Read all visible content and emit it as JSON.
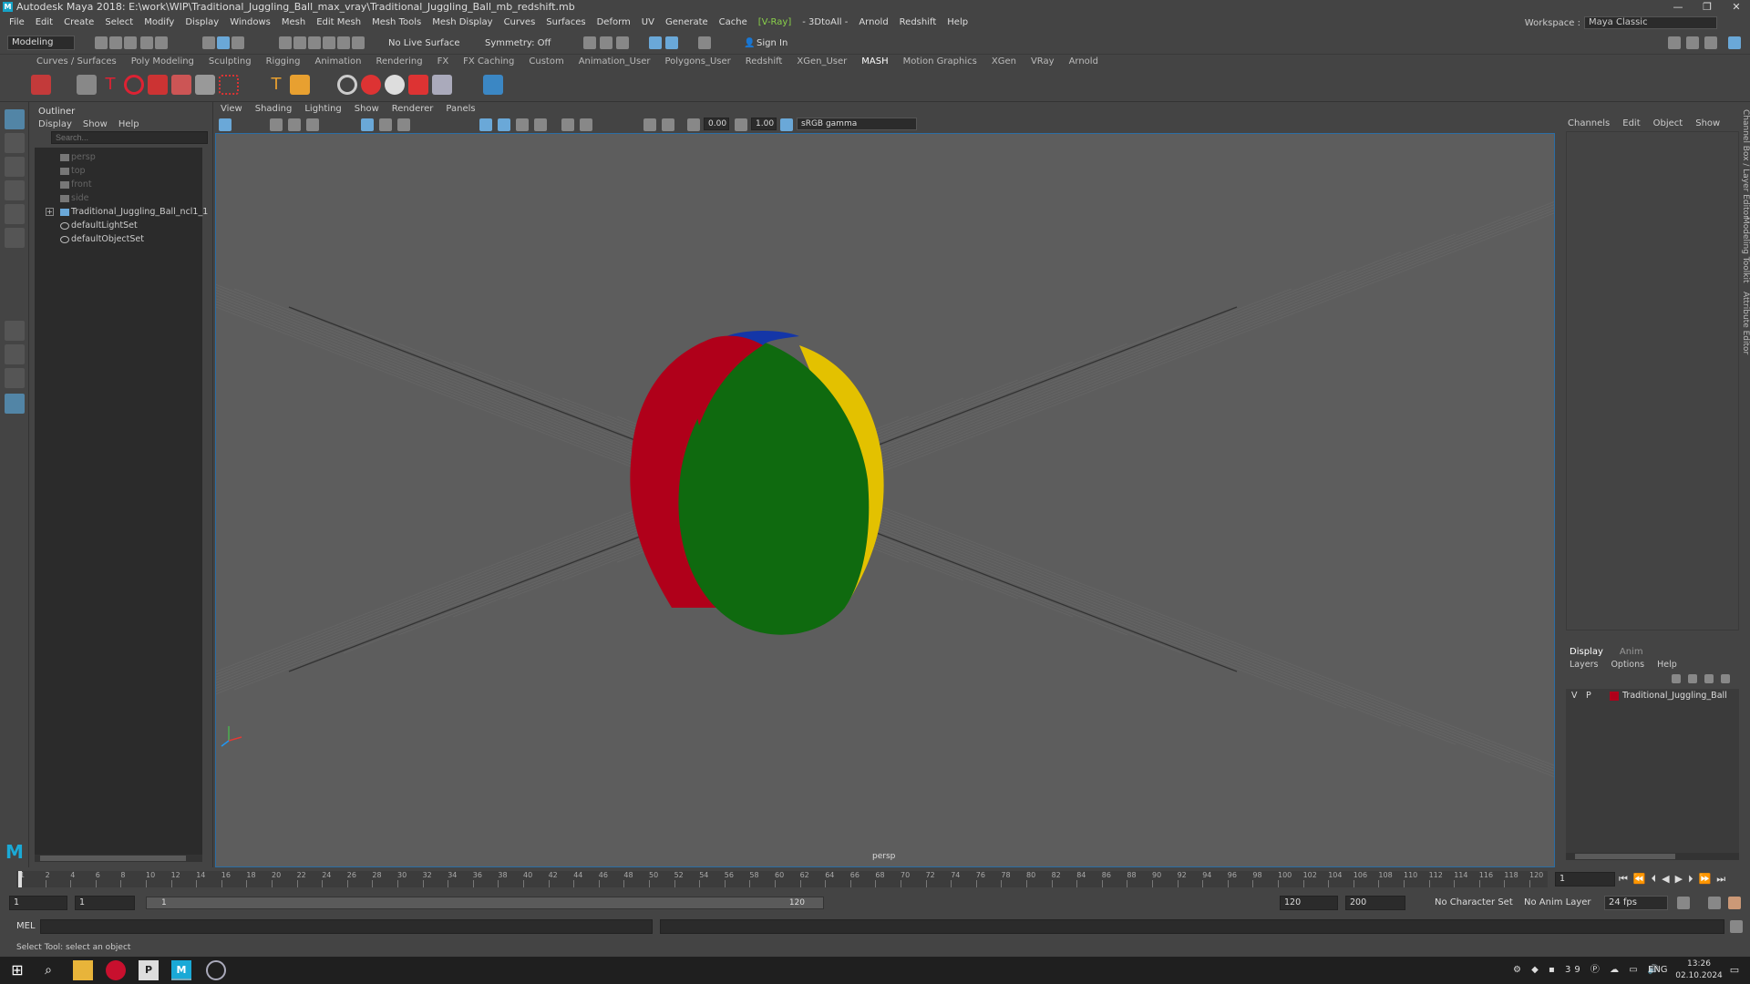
{
  "window": {
    "title": "Autodesk Maya 2018: E:\\work\\WIP\\Traditional_Juggling_Ball_max_vray\\Traditional_Juggling_Ball_mb_redshift.mb",
    "controls": [
      "—",
      "❐",
      "✕"
    ]
  },
  "menubar": {
    "items": [
      "File",
      "Edit",
      "Create",
      "Select",
      "Modify",
      "Display",
      "Windows",
      "Mesh",
      "Edit Mesh",
      "Mesh Tools",
      "Mesh Display",
      "Curves",
      "Surfaces",
      "Deform",
      "UV",
      "Generate",
      "Cache",
      "[V-Ray]",
      "- 3DtoAll -",
      "Arnold",
      "Redshift",
      "Help"
    ],
    "workspace_label": "Workspace :",
    "workspace_value": "Maya Classic"
  },
  "statusline": {
    "mode": "Modeling",
    "live_surface": "No Live Surface",
    "symmetry": "Symmetry: Off",
    "sign_in": "Sign In"
  },
  "shelf": {
    "tabs": [
      "Curves / Surfaces",
      "Poly Modeling",
      "Sculpting",
      "Rigging",
      "Animation",
      "Rendering",
      "FX",
      "FX Caching",
      "Custom",
      "Animation_User",
      "Polygons_User",
      "Redshift",
      "XGen_User",
      "MASH",
      "Motion Graphics",
      "XGen",
      "VRay",
      "Arnold"
    ],
    "active_tab": "MASH"
  },
  "outliner": {
    "title": "Outliner",
    "menu": [
      "Display",
      "Show",
      "Help"
    ],
    "search_placeholder": "Search...",
    "items": [
      {
        "label": "persp",
        "dim": true
      },
      {
        "label": "top",
        "dim": true
      },
      {
        "label": "front",
        "dim": true
      },
      {
        "label": "side",
        "dim": true
      },
      {
        "label": "Traditional_Juggling_Ball_ncl1_1",
        "dim": false
      },
      {
        "label": "defaultLightSet",
        "dim": false
      },
      {
        "label": "defaultObjectSet",
        "dim": false
      }
    ]
  },
  "viewport": {
    "menu": [
      "View",
      "Shading",
      "Lighting",
      "Show",
      "Renderer",
      "Panels"
    ],
    "exposure": "0.00",
    "gamma": "1.00",
    "colorspace": "sRGB gamma",
    "camera_label": "persp",
    "ball_colors": {
      "red": "#b0001a",
      "green": "#0f6a0f",
      "yellow": "#e3c100",
      "blue": "#1436a8"
    }
  },
  "channelbox": {
    "menu": [
      "Channels",
      "Edit",
      "Object",
      "Show"
    ],
    "layer_tabs": [
      "Display",
      "Anim"
    ],
    "layer_menu": [
      "Layers",
      "Options",
      "Help"
    ],
    "layer": {
      "v": "V",
      "p": "P",
      "name": "Traditional_Juggling_Ball",
      "color": "#b0001a"
    },
    "side_tabs": [
      "Channel Box / Layer Editor",
      "Modeling Toolkit",
      "Attribute Editor"
    ]
  },
  "timeslider": {
    "ticks": [
      "1",
      "2",
      "4",
      "6",
      "8",
      "10",
      "12",
      "14",
      "16",
      "18",
      "20",
      "22",
      "24",
      "26",
      "28",
      "30",
      "32",
      "34",
      "36",
      "38",
      "40",
      "42",
      "44",
      "46",
      "48",
      "50",
      "52",
      "54",
      "56",
      "58",
      "60",
      "62",
      "64",
      "66",
      "68",
      "70",
      "72",
      "74",
      "76",
      "78",
      "80",
      "82",
      "84",
      "86",
      "88",
      "90",
      "92",
      "94",
      "96",
      "98",
      "100",
      "102",
      "104",
      "106",
      "108",
      "110",
      "112",
      "114",
      "116",
      "118",
      "120"
    ],
    "current_frame": "1"
  },
  "rangebar": {
    "start": "1",
    "anim_start": "1",
    "range_start_label": "1",
    "range_end_label": "120",
    "anim_end": "120",
    "end": "200",
    "character_set": "No Character Set",
    "anim_layer": "No Anim Layer",
    "fps": "24 fps"
  },
  "cmdline": {
    "label": "MEL"
  },
  "helpline": {
    "text": "Select Tool: select an object"
  },
  "taskbar": {
    "tray_number": "39",
    "lang": "ENG",
    "time": "13:26",
    "date": "02.10.2024"
  }
}
